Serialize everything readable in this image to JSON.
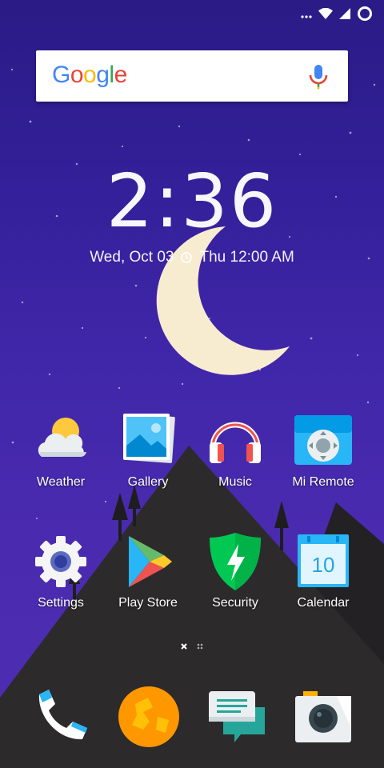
{
  "search": {
    "logo_text": [
      "G",
      "o",
      "o",
      "g",
      "l",
      "e"
    ],
    "mic_icon": "microphone-icon"
  },
  "clock": {
    "time": "2:36",
    "date": "Wed, Oct 03",
    "alarm": "Thu 12:00 AM"
  },
  "apps_row1": [
    {
      "label": "Weather",
      "icon": "weather-icon"
    },
    {
      "label": "Gallery",
      "icon": "gallery-icon"
    },
    {
      "label": "Music",
      "icon": "music-icon"
    },
    {
      "label": "Mi Remote",
      "icon": "mi-remote-icon"
    }
  ],
  "apps_row2": [
    {
      "label": "Settings",
      "icon": "settings-icon"
    },
    {
      "label": "Play Store",
      "icon": "play-store-icon"
    },
    {
      "label": "Security",
      "icon": "security-icon"
    },
    {
      "label": "Calendar",
      "icon": "calendar-icon",
      "day": "10"
    }
  ],
  "dock": [
    {
      "icon": "phone-icon"
    },
    {
      "icon": "browser-icon"
    },
    {
      "icon": "messaging-icon"
    },
    {
      "icon": "camera-icon"
    }
  ],
  "colors": {
    "wallpaper_top": "#2a1b86",
    "wallpaper_bottom": "#4e2db0",
    "mountain": "#2d2a2c",
    "moon": "#f7ecd0"
  }
}
